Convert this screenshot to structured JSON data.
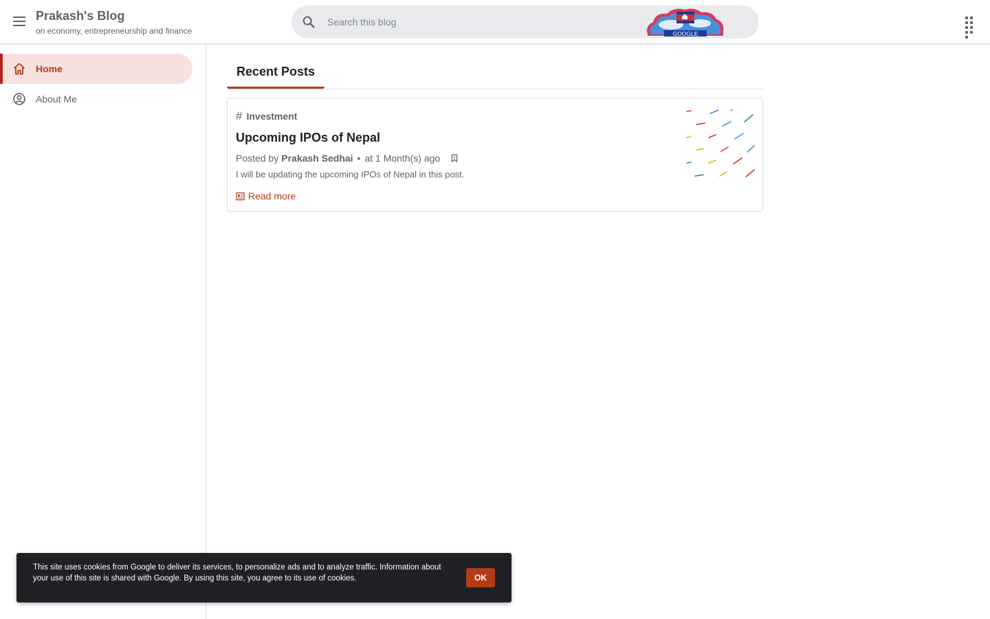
{
  "header": {
    "blog_title": "Prakash's Blog",
    "blog_description": "on economy, entrepreneurship and finance",
    "search_placeholder": "Search this blog",
    "doodle_text": "GOOGLE",
    "icons": {
      "menu": "menu-icon",
      "search": "search-icon",
      "apps": "apps-grid-icon"
    }
  },
  "sidebar": {
    "items": [
      {
        "label": "Home",
        "icon": "home-icon",
        "active": true
      },
      {
        "label": "About Me",
        "icon": "account-circle-icon",
        "active": false
      }
    ]
  },
  "main": {
    "tab_label": "Recent Posts",
    "post": {
      "label": "Investment",
      "title": "Upcoming IPOs of Nepal",
      "posted_by": "Posted by",
      "author": "Prakash Sedhai",
      "separator": "•",
      "time": "at 1 Month(s) ago",
      "snippet": "I will be updating the upcoming IPOs of Nepal in this post.",
      "read_more": "Read more"
    }
  },
  "cookie_bar": {
    "text": "This site uses cookies from Google to deliver its services, to personalize ads and to analyze traffic. Information about your use of this site is shared with Google. By using this site, you agree to its use of cookies.",
    "ok_label": "OK"
  },
  "colors": {
    "accent": "#b23c17",
    "active_nav_bg": "#f7e1df",
    "search_bg": "#e8eaed",
    "cookie_bg": "#202124"
  }
}
